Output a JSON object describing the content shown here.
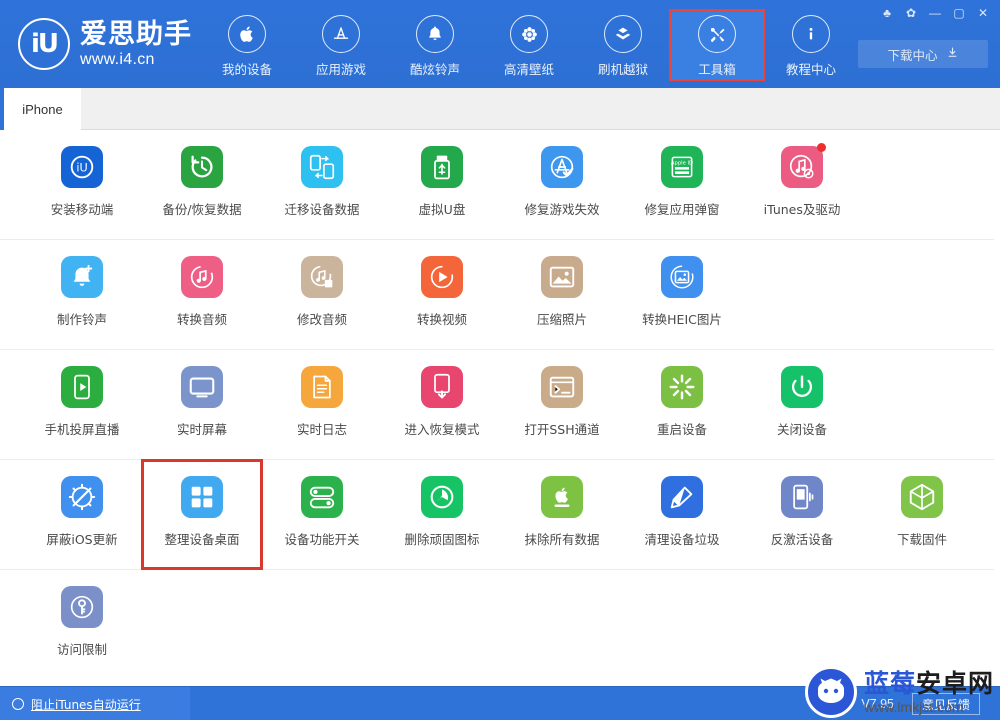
{
  "app": {
    "brand_name": "爱思助手",
    "brand_url": "www.i4.cn",
    "logo_mark": "iU",
    "accent_blue": "#2f72d8",
    "highlight_red": "#d9382b"
  },
  "header": {
    "nav": [
      {
        "label": "我的设备",
        "icon": "apple-icon",
        "active": false
      },
      {
        "label": "应用游戏",
        "icon": "appstore-icon",
        "active": false
      },
      {
        "label": "酷炫铃声",
        "icon": "bell-icon",
        "active": false
      },
      {
        "label": "高清壁纸",
        "icon": "flower-icon",
        "active": false
      },
      {
        "label": "刷机越狱",
        "icon": "dropbox-icon",
        "active": false
      },
      {
        "label": "工具箱",
        "icon": "tools-icon",
        "active": true
      },
      {
        "label": "教程中心",
        "icon": "info-icon",
        "active": false
      }
    ],
    "window_buttons": [
      {
        "name": "skin-icon",
        "glyph": "♣"
      },
      {
        "name": "gear-icon",
        "glyph": "✿"
      },
      {
        "name": "minimize-icon",
        "glyph": "—"
      },
      {
        "name": "maximize-icon",
        "glyph": "▢"
      },
      {
        "name": "close-icon",
        "glyph": "✕"
      }
    ],
    "download_center": {
      "label": "下载中心",
      "icon": "download-icon"
    }
  },
  "tabs": [
    {
      "label": "iPhone",
      "active": true
    }
  ],
  "toolbox": {
    "rows": [
      [
        {
          "label": "安装移动端",
          "icon": "i4-app-icon",
          "bg": "#1464d6",
          "dot": false
        },
        {
          "label": "备份/恢复数据",
          "icon": "backup-restore-icon",
          "bg": "#2aa341",
          "dot": false
        },
        {
          "label": "迁移设备数据",
          "icon": "migrate-data-icon",
          "bg": "#2ec0f0",
          "dot": false
        },
        {
          "label": "虚拟U盘",
          "icon": "usb-drive-icon",
          "bg": "#23a94b",
          "dot": false
        },
        {
          "label": "修复游戏失效",
          "icon": "appstore-fix-icon",
          "bg": "#3d97ef",
          "dot": false
        },
        {
          "label": "修复应用弹窗",
          "icon": "appleid-icon",
          "bg": "#1fb457",
          "dot": false
        },
        {
          "label": "iTunes及驱动",
          "icon": "itunes-driver-icon",
          "bg": "#ec5c82",
          "dot": true
        }
      ],
      [
        {
          "label": "制作铃声",
          "icon": "make-ringtone-icon",
          "bg": "#41b3f2",
          "dot": false
        },
        {
          "label": "转换音频",
          "icon": "convert-audio-icon",
          "bg": "#ef5f85",
          "dot": false
        },
        {
          "label": "修改音频",
          "icon": "edit-audio-icon",
          "bg": "#cbb49c",
          "dot": false
        },
        {
          "label": "转换视频",
          "icon": "convert-video-icon",
          "bg": "#f4653a",
          "dot": false
        },
        {
          "label": "压缩照片",
          "icon": "compress-photo-icon",
          "bg": "#c8ab8c",
          "dot": false
        },
        {
          "label": "转换HEIC图片",
          "icon": "heic-convert-icon",
          "bg": "#3f90ef",
          "dot": false
        }
      ],
      [
        {
          "label": "手机投屏直播",
          "icon": "screen-cast-icon",
          "bg": "#2bae3f",
          "dot": false
        },
        {
          "label": "实时屏幕",
          "icon": "live-screen-icon",
          "bg": "#7b95cc",
          "dot": false
        },
        {
          "label": "实时日志",
          "icon": "live-log-icon",
          "bg": "#f5a73c",
          "dot": false
        },
        {
          "label": "进入恢复模式",
          "icon": "recovery-mode-icon",
          "bg": "#e8456f",
          "dot": false
        },
        {
          "label": "打开SSH通道",
          "icon": "ssh-terminal-icon",
          "bg": "#c9ab8a",
          "dot": false
        },
        {
          "label": "重启设备",
          "icon": "reboot-device-icon",
          "bg": "#7bc043",
          "dot": false
        },
        {
          "label": "关闭设备",
          "icon": "power-off-icon",
          "bg": "#15c26a",
          "dot": false
        }
      ],
      [
        {
          "label": "屏蔽iOS更新",
          "icon": "block-update-icon",
          "bg": "#3f90ef",
          "dot": false,
          "highlight": false
        },
        {
          "label": "整理设备桌面",
          "icon": "arrange-desktop-icon",
          "bg": "#41a9f0",
          "dot": false,
          "highlight": true
        },
        {
          "label": "设备功能开关",
          "icon": "feature-toggle-icon",
          "bg": "#2bb24c",
          "dot": false,
          "highlight": false
        },
        {
          "label": "删除顽固图标",
          "icon": "delete-icon-icon",
          "bg": "#16c466",
          "dot": false,
          "highlight": false
        },
        {
          "label": "抹除所有数据",
          "icon": "erase-data-icon",
          "bg": "#7dc242",
          "dot": false,
          "highlight": false
        },
        {
          "label": "清理设备垃圾",
          "icon": "clean-junk-icon",
          "bg": "#2f6fe0",
          "dot": false,
          "highlight": false
        },
        {
          "label": "反激活设备",
          "icon": "deactivate-icon",
          "bg": "#6f86c9",
          "dot": false,
          "highlight": false
        },
        {
          "label": "下载固件",
          "icon": "download-firmware-icon",
          "bg": "#80c449",
          "dot": false,
          "highlight": false
        }
      ],
      [
        {
          "label": "访问限制",
          "icon": "access-restrict-icon",
          "bg": "#7b8fc9",
          "dot": false
        }
      ]
    ]
  },
  "statusbar": {
    "block_itunes_label": "阻止iTunes自动运行",
    "version": "V7.95",
    "feedback_label": "意见反馈"
  },
  "watermark": {
    "brand_blue": "蓝莓",
    "brand_black": "安卓网",
    "url": "www.lmkjst.com"
  }
}
